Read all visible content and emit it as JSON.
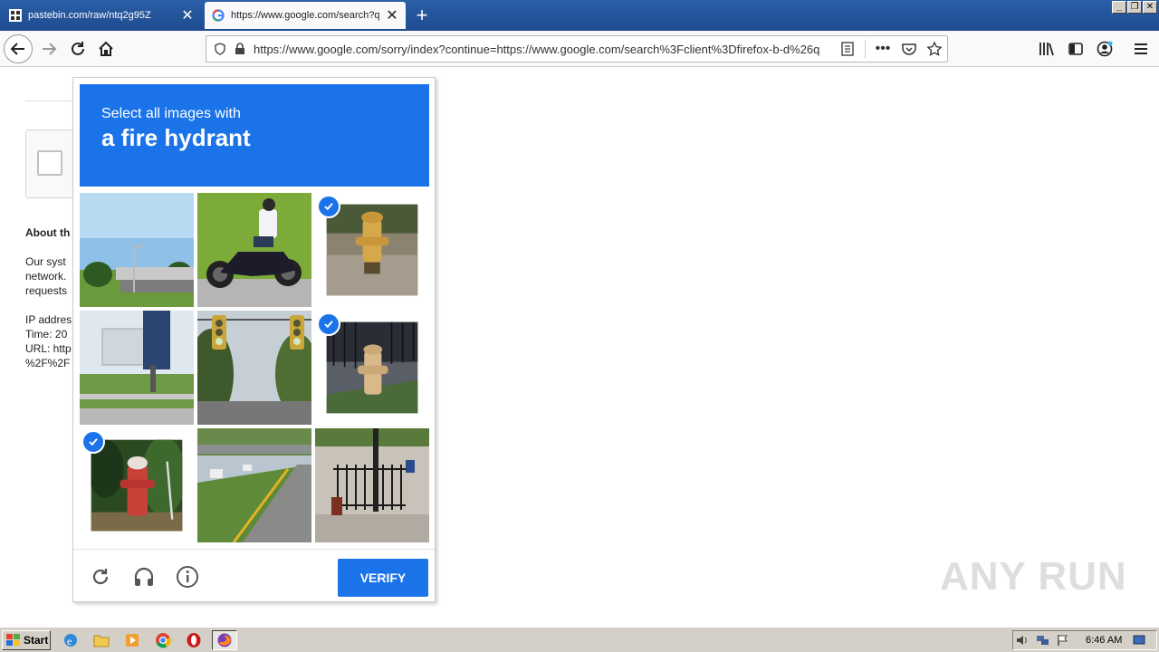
{
  "browser": {
    "tabs": [
      {
        "title": "pastebin.com/raw/ntq2g95Z",
        "favicon": "pastebin-icon",
        "active": false
      },
      {
        "title": "https://www.google.com/search?q",
        "favicon": "google-icon",
        "active": true
      }
    ],
    "url": "https://www.google.com/sorry/index?continue=https://www.google.com/search%3Fclient%3Dfirefox-b-d%26q"
  },
  "background_page": {
    "about_heading": "About th",
    "para_lines": [
      "Our syst",
      "network.",
      "requests"
    ],
    "info_lines": [
      "IP addres",
      "Time: 20",
      "URL: http",
      "%2F%2F"
    ]
  },
  "captcha": {
    "prompt_line1": "Select all images with",
    "prompt_line2": "a fire hydrant",
    "tiles": [
      {
        "name": "tile-overpass",
        "selected": false
      },
      {
        "name": "tile-motorcycle",
        "selected": false
      },
      {
        "name": "tile-hydrant-yellow",
        "selected": true
      },
      {
        "name": "tile-billboard",
        "selected": false
      },
      {
        "name": "tile-traffic-lights",
        "selected": false
      },
      {
        "name": "tile-hydrant-sidewalk",
        "selected": true
      },
      {
        "name": "tile-hydrant-red",
        "selected": true
      },
      {
        "name": "tile-highway",
        "selected": false
      },
      {
        "name": "tile-fence-hydrant",
        "selected": false
      }
    ],
    "verify_label": "VERIFY",
    "icons": [
      "reload-icon",
      "headphones-icon",
      "info-icon"
    ],
    "accent_color": "#1a73e8"
  },
  "watermark": "ANY RUN",
  "taskbar": {
    "start_label": "Start",
    "clock": "6:46 AM"
  }
}
